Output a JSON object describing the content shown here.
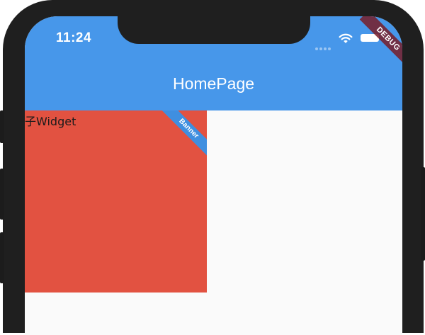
{
  "status_bar": {
    "time": "11:24",
    "icons": [
      "signal-dots-icon",
      "wifi-icon",
      "battery-icon"
    ]
  },
  "app_bar": {
    "title": "HomePage",
    "background": "#4797ea"
  },
  "debug_banner": {
    "label": "DEBUG"
  },
  "content": {
    "child_label": "子Widget",
    "box_color": "#e25241",
    "banner_label": "Banner",
    "banner_color": "#3f8fe0"
  }
}
